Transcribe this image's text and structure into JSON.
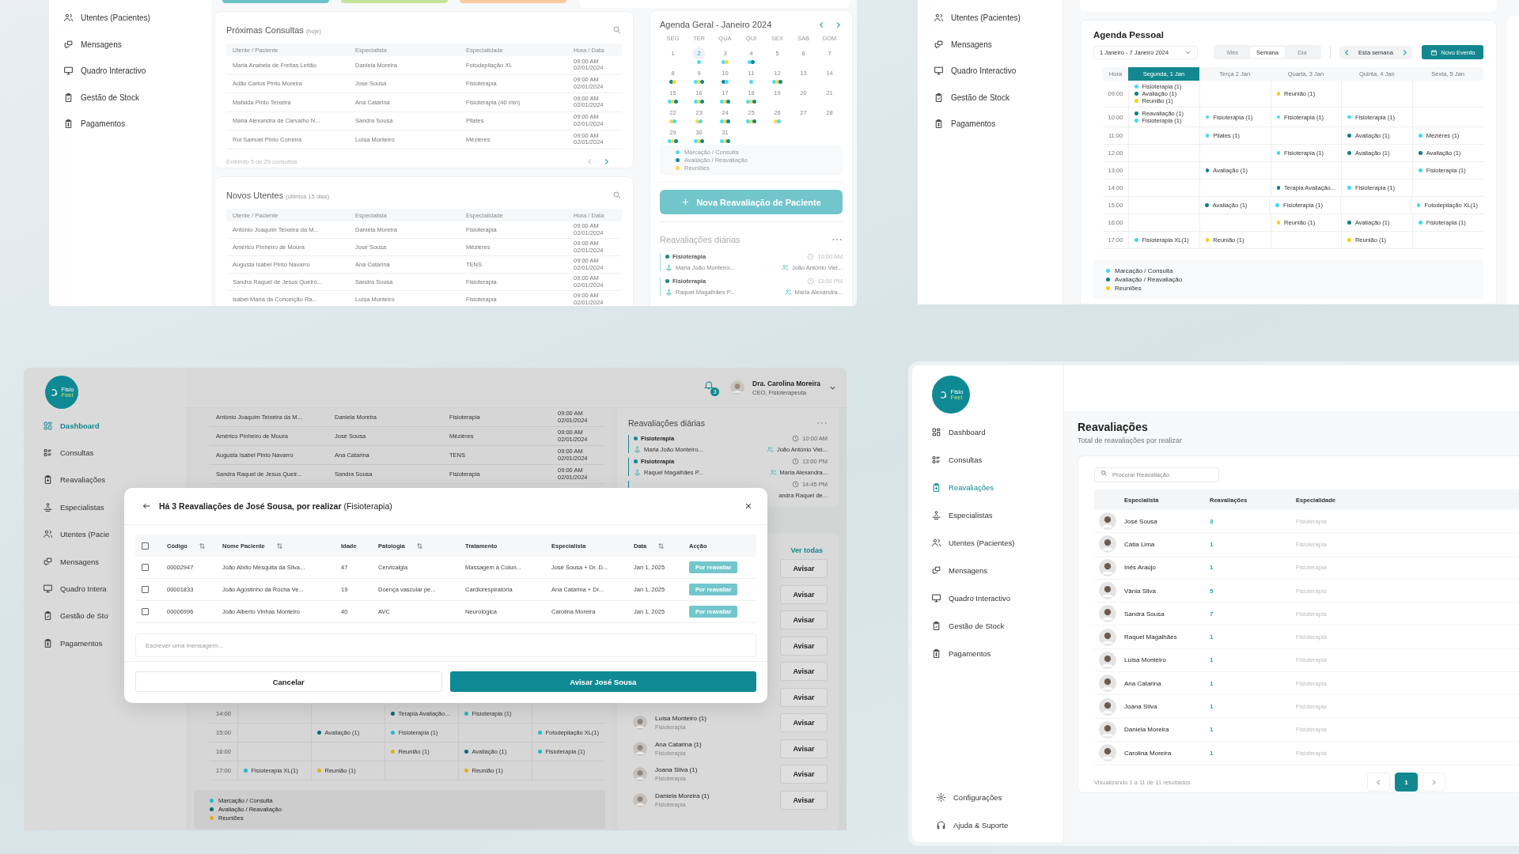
{
  "dashboard_screen": {
    "sidebar": [
      {
        "label": "Utentes (Pacientes)",
        "selected": false
      },
      {
        "label": "Mensagens",
        "selected": false
      },
      {
        "label": "Quadro Interactivo",
        "selected": false
      },
      {
        "label": "Gestão de Stock",
        "selected": false
      },
      {
        "label": "Pagamentos",
        "selected": false
      }
    ],
    "upcoming": {
      "title": "Próximas Consultas",
      "note": "(hoje)",
      "columns": [
        "Utente / Paciente",
        "Especialista",
        "Especialidade",
        "Hora / Data"
      ],
      "rows": [
        {
          "patient": "Maria Anabela de Freitas Leitão",
          "specialist": "Daniela Moreira",
          "specialty": "Fotodepilação XL",
          "time": "09:00 AM",
          "date": "02/01/2024"
        },
        {
          "patient": "Adão Carlos Pinto Moreira",
          "specialist": "Jose Sousa",
          "specialty": "Fisioterapia",
          "time": "09:00 AM",
          "date": "02/01/2024"
        },
        {
          "patient": "Mafalda Pinto Teixeira",
          "specialist": "Ana Catarina",
          "specialty": "Fisioterapia (40 min)",
          "time": "09:00 AM",
          "date": "02/01/2024"
        },
        {
          "patient": "Maria Alexandra de Carvalho N...",
          "specialist": "Sandra Sousa",
          "specialty": "Pilates",
          "time": "09:00 AM",
          "date": "02/01/2024"
        },
        {
          "patient": "Rui Samuel Pinto Correira",
          "specialist": "Luísa Monteiro",
          "specialty": "Mézières",
          "time": "09:00 AM",
          "date": "02/01/2024"
        }
      ],
      "footer": "Exibindo 5 de 25 consultas"
    },
    "new_patients": {
      "title": "Novos Utentes",
      "note": "(últimos 15 dias)",
      "columns": [
        "Utente / Paciente",
        "Especialista",
        "Especialidade",
        "Hora / Data"
      ],
      "rows": [
        {
          "patient": "António Joaquim Teixeira da M...",
          "specialist": "Daniela Moreira",
          "specialty": "Fisioterapia",
          "time": "09:00 AM",
          "date": "02/01/2024"
        },
        {
          "patient": "Américo Pinheiro de Moura",
          "specialist": "José Sousa",
          "specialty": "Mézières",
          "time": "09:00 AM",
          "date": "02/01/2024"
        },
        {
          "patient": "Augusta Isabel Pinto Navarro",
          "specialist": "Ana Catarina",
          "specialty": "TENS",
          "time": "09:00 AM",
          "date": "02/01/2024"
        },
        {
          "patient": "Sandra Raquel de Jesus Queiró...",
          "specialist": "Sandra Sousa",
          "specialty": "Fisioterapia",
          "time": "09:00 AM",
          "date": "02/01/2024"
        },
        {
          "patient": "Isabel Maria da Conceição Ra...",
          "specialist": "Luísa Monteiro",
          "specialty": "Fisioterapia",
          "time": "09:00 AM",
          "date": "02/01/2024"
        }
      ]
    },
    "calendar": {
      "title": "Agenda Geral - Janeiro 2024",
      "weekdays": [
        "SEG",
        "TER",
        "QUA",
        "QUI",
        "SEX",
        "SAB",
        "DOM"
      ],
      "days": [
        {
          "day": "1",
          "selected": false
        },
        {
          "day": "2",
          "selected": true,
          "events": [
            {
              "kind": "consulta"
            }
          ]
        },
        {
          "day": "3",
          "selected": false,
          "events": [
            {
              "kind": "consulta"
            },
            {
              "kind": "reuniao"
            }
          ]
        },
        {
          "day": "4",
          "selected": false,
          "events": [
            {
              "kind": "consulta"
            },
            {
              "kind": "avaliacao"
            }
          ]
        },
        {
          "day": "5",
          "selected": false
        },
        {
          "day": "6",
          "selected": false
        },
        {
          "day": "7",
          "selected": false
        },
        {
          "day": "8",
          "selected": false,
          "events": [
            {
              "kind": "avaliacao"
            },
            {
              "kind": "reuniao"
            }
          ]
        },
        {
          "day": "9",
          "selected": false,
          "events": [
            {
              "kind": "consulta"
            },
            {
              "kind": "reuniao"
            },
            {
              "kind": "avaliacao"
            }
          ]
        },
        {
          "day": "10",
          "selected": false,
          "events": [
            {
              "kind": "avaliacao"
            },
            {
              "kind": "consulta"
            }
          ]
        },
        {
          "day": "11",
          "selected": false,
          "events": [
            {
              "kind": "consulta"
            }
          ]
        },
        {
          "day": "12",
          "selected": false,
          "events": [
            {
              "kind": "consulta"
            },
            {
              "kind": "reuniao"
            },
            {
              "kind": "avaliacao"
            }
          ]
        },
        {
          "day": "13",
          "selected": false
        },
        {
          "day": "14",
          "selected": false
        },
        {
          "day": "15",
          "selected": false,
          "events": [
            {
              "kind": "consulta"
            },
            {
              "kind": "reuniao"
            },
            {
              "kind": "avaliacao"
            }
          ]
        },
        {
          "day": "16",
          "selected": false,
          "events": [
            {
              "kind": "consulta"
            },
            {
              "kind": "reuniao"
            },
            {
              "kind": "avaliacao"
            }
          ]
        },
        {
          "day": "17",
          "selected": false,
          "events": [
            {
              "kind": "consulta"
            },
            {
              "kind": "reuniao"
            },
            {
              "kind": "avaliacao"
            }
          ]
        },
        {
          "day": "18",
          "selected": false,
          "events": [
            {
              "kind": "consulta"
            },
            {
              "kind": "reuniao"
            },
            {
              "kind": "avaliacao"
            }
          ]
        },
        {
          "day": "19",
          "selected": false
        },
        {
          "day": "20",
          "selected": false
        },
        {
          "day": "21",
          "selected": false
        },
        {
          "day": "22",
          "selected": false,
          "events": [
            {
              "kind": "reuniao"
            },
            {
              "kind": "consulta"
            }
          ]
        },
        {
          "day": "23",
          "selected": false,
          "events": [
            {
              "kind": "reuniao"
            },
            {
              "kind": "consulta"
            }
          ]
        },
        {
          "day": "24",
          "selected": false,
          "events": [
            {
              "kind": "consulta"
            },
            {
              "kind": "reuniao"
            },
            {
              "kind": "avaliacao"
            }
          ]
        },
        {
          "day": "25",
          "selected": false,
          "events": [
            {
              "kind": "consulta"
            },
            {
              "kind": "reuniao"
            },
            {
              "kind": "avaliacao"
            }
          ]
        },
        {
          "day": "26",
          "selected": false,
          "events": [
            {
              "kind": "reuniao"
            },
            {
              "kind": "consulta"
            }
          ]
        },
        {
          "day": "27",
          "selected": false
        },
        {
          "day": "28",
          "selected": false
        },
        {
          "day": "29",
          "selected": false,
          "events": [
            {
              "kind": "consulta"
            },
            {
              "kind": "reuniao"
            },
            {
              "kind": "avaliacao"
            }
          ]
        },
        {
          "day": "30",
          "selected": false,
          "events": [
            {
              "kind": "consulta"
            },
            {
              "kind": "reuniao"
            },
            {
              "kind": "avaliacao"
            }
          ]
        },
        {
          "day": "31",
          "selected": false,
          "events": [
            {
              "kind": "consulta"
            },
            {
              "kind": "reuniao"
            },
            {
              "kind": "avaliacao"
            }
          ]
        }
      ],
      "legend": [
        {
          "label": "Marcação / Consulta",
          "kind": "consulta",
          "color": "#4fdcee"
        },
        {
          "label": "Avaliação / Reavaliação",
          "kind": "avaliacao",
          "color": "#16878f"
        },
        {
          "label": "Reuniões",
          "kind": "reuniao",
          "color": "#f6d84a"
        }
      ]
    },
    "new_button": "Nova Reavaliação de Paciente",
    "daily": {
      "title": "Reavaliações diárias",
      "entries": [
        {
          "type": "Fisioterapia",
          "time": "10:00 AM",
          "patient": "Maria João Monteiro...",
          "specialist": "João António Viei..."
        },
        {
          "type": "Fisioterapia",
          "time": "13:00 PM",
          "patient": "Raquel Magalhães P...",
          "specialist": "Maria Alexandra..."
        }
      ]
    }
  },
  "agenda_screen": {
    "sidebar": [
      {
        "label": "Utentes (Pacientes)",
        "selected": false
      },
      {
        "label": "Mensagens",
        "selected": false
      },
      {
        "label": "Quadro Interactivo",
        "selected": false
      },
      {
        "label": "Gestão de Stock",
        "selected": false
      },
      {
        "label": "Pagamentos",
        "selected": false
      }
    ],
    "title": "Agenda Pessoal",
    "range": "1 Janeiro - 7 Janeiro 2024",
    "views": [
      {
        "label": "Mês",
        "selected": false
      },
      {
        "label": "Semana",
        "selected": true
      },
      {
        "label": "Dia",
        "selected": false
      }
    ],
    "week_label": "Esta semana",
    "new_event": "Novo Evento",
    "hour_header": "Hora",
    "columns": [
      {
        "label": "Segunda, 1 Jan",
        "selected": true
      },
      {
        "label": "Terça 2 Jan",
        "selected": false
      },
      {
        "label": "Quarta, 3 Jan",
        "selected": false
      },
      {
        "label": "Quinta, 4 Jan",
        "selected": false
      },
      {
        "label": "Sexta, 5 Jan",
        "selected": false
      }
    ],
    "rows": [
      {
        "hour": "09:00",
        "cells": [
          [
            {
              "label": "Fisioterapia (1)",
              "kind": "consulta"
            },
            {
              "label": "Avaliação (1)",
              "kind": "avaliacao"
            },
            {
              "label": "Reunião (1)",
              "kind": "reuniao"
            }
          ],
          [],
          [
            {
              "label": "Reunião (1)",
              "kind": "reuniao"
            }
          ],
          [],
          []
        ]
      },
      {
        "hour": "10:00",
        "cells": [
          [
            {
              "label": "Reavaliação (1)",
              "kind": "avaliacao"
            },
            {
              "label": "Fisioterapia (1)",
              "kind": "consulta"
            }
          ],
          [
            {
              "label": "Fisioterapia (1)",
              "kind": "consulta"
            }
          ],
          [
            {
              "label": "Fisioterapia (1)",
              "kind": "consulta"
            }
          ],
          [
            {
              "label": "Fisioterapia (1)",
              "kind": "consulta"
            }
          ],
          []
        ]
      },
      {
        "hour": "11:00",
        "cells": [
          [],
          [
            {
              "label": "Pilates (1)",
              "kind": "consulta"
            }
          ],
          [],
          [
            {
              "label": "Avaliação (1)",
              "kind": "avaliacao"
            }
          ],
          [
            {
              "label": "Mézières (1)",
              "kind": "consulta"
            }
          ]
        ]
      },
      {
        "hour": "12:00",
        "cells": [
          [],
          [],
          [
            {
              "label": "Fisioterapia (1)",
              "kind": "consulta"
            }
          ],
          [
            {
              "label": "Avaliação (1)",
              "kind": "avaliacao"
            }
          ],
          [
            {
              "label": "Avaliação (1)",
              "kind": "avaliacao"
            }
          ]
        ]
      },
      {
        "hour": "13:00",
        "cells": [
          [],
          [
            {
              "label": "Avaliação (1)",
              "kind": "avaliacao"
            }
          ],
          [],
          [],
          [
            {
              "label": "Fisioterapia (1)",
              "kind": "consulta"
            }
          ]
        ]
      },
      {
        "hour": "14:00",
        "cells": [
          [],
          [],
          [
            {
              "label": "Terapia Avaliação...",
              "kind": "avaliacao"
            }
          ],
          [
            {
              "label": "Fisioterapia (1)",
              "kind": "consulta"
            }
          ],
          []
        ]
      },
      {
        "hour": "15:00",
        "cells": [
          [],
          [
            {
              "label": "Avaliação (1)",
              "kind": "avaliacao"
            }
          ],
          [
            {
              "label": "Fisioterapia (1)",
              "kind": "consulta"
            }
          ],
          [],
          [
            {
              "label": "Fotodepilação XL(1)",
              "kind": "consulta"
            }
          ]
        ]
      },
      {
        "hour": "16:00",
        "cells": [
          [],
          [],
          [
            {
              "label": "Reunião (1)",
              "kind": "reuniao"
            }
          ],
          [
            {
              "label": "Avaliação (1)",
              "kind": "avaliacao"
            }
          ],
          [
            {
              "label": "Fisioterapia (1)",
              "kind": "consulta"
            }
          ]
        ]
      },
      {
        "hour": "17:00",
        "cells": [
          [
            {
              "label": "Fisioterapia XL(1)",
              "kind": "consulta"
            }
          ],
          [
            {
              "label": "Reunião (1)",
              "kind": "reuniao"
            }
          ],
          [],
          [
            {
              "label": "Reunião (1)",
              "kind": "reuniao"
            }
          ],
          []
        ]
      }
    ],
    "legend": [
      {
        "label": "Marcação / Consulta",
        "kind": "consulta",
        "color": "#3fdcf0"
      },
      {
        "label": "Avaliação / Reavaliação",
        "kind": "avaliacao",
        "color": "#0f7f88"
      },
      {
        "label": "Reuniões",
        "kind": "reuniao",
        "color": "#f6cf10"
      }
    ]
  },
  "modal_screen": {
    "logo": {
      "line1": "Fisio",
      "line2": "Feel"
    },
    "sidebar": [
      {
        "label": "Dashboard",
        "selected": true
      },
      {
        "label": "Consultas",
        "selected": false
      },
      {
        "label": "Reavaliações",
        "selected": false
      },
      {
        "label": "Especialistas",
        "selected": false
      },
      {
        "label": "Utentes (Pacie",
        "selected": false
      },
      {
        "label": "Mensagens",
        "selected": false
      },
      {
        "label": "Quadro Intera",
        "selected": false
      },
      {
        "label": "Gestão de Sto",
        "selected": false
      },
      {
        "label": "Pagamentos",
        "selected": false
      }
    ],
    "notifications": "3",
    "user": {
      "name": "Dra. Carolina Moreira",
      "role": "CEO, Fisioterapeuta"
    },
    "table_rows": [
      {
        "patient": "António Joaquim Teixeira da M...",
        "specialist": "Daniela Moreira",
        "specialty": "Fisioterapia",
        "time": "09:00 AM",
        "date": "02/01/2024"
      },
      {
        "patient": "Américo Pinheiro de Moura",
        "specialist": "José Sousa",
        "specialty": "Mézières",
        "time": "09:00 AM",
        "date": "02/01/2024"
      },
      {
        "patient": "Augusta Isabel Pinto Navarro",
        "specialist": "Ana Catarina",
        "specialty": "TENS",
        "time": "09:00 AM",
        "date": "02/01/2024"
      },
      {
        "patient": "Sandra Raquel de Jesus Queir...",
        "specialist": "Sandra Sousa",
        "specialty": "Fisioterapia",
        "time": "09:00 AM",
        "date": "02/01/2024"
      }
    ],
    "agenda_rows": [
      {
        "hour": "14:00",
        "cells": [
          [],
          [],
          [
            {
              "label": "Terapia Avaliação...",
              "kind": "avaliacao"
            }
          ],
          [
            {
              "label": "Fisioterapia (1)",
              "kind": "consulta"
            }
          ],
          []
        ]
      },
      {
        "hour": "15:00",
        "cells": [
          [],
          [
            {
              "label": "Avaliação (1)",
              "kind": "avaliacao"
            }
          ],
          [
            {
              "label": "Fisioterapia (1)",
              "kind": "consulta"
            }
          ],
          [],
          [
            {
              "label": "Fotodepilação XL(1)",
              "kind": "consulta"
            }
          ]
        ]
      },
      {
        "hour": "16:00",
        "cells": [
          [],
          [],
          [
            {
              "label": "Reunião (1)",
              "kind": "reuniao"
            }
          ],
          [
            {
              "label": "Avaliação (1)",
              "kind": "avaliacao"
            }
          ],
          [
            {
              "label": "Fisioterapia (1)",
              "kind": "consulta"
            }
          ]
        ]
      },
      {
        "hour": "17:00",
        "cells": [
          [
            {
              "label": "Fisioterapia XL(1)",
              "kind": "consulta"
            }
          ],
          [
            {
              "label": "Reunião (1)",
              "kind": "reuniao"
            }
          ],
          [],
          [
            {
              "label": "Reunião (1)",
              "kind": "reuniao"
            }
          ],
          []
        ]
      }
    ],
    "legend": [
      {
        "label": "Marcação / Consulta",
        "kind": "consulta",
        "color": "#26b8c9"
      },
      {
        "label": "Avaliação / Reavaliação",
        "kind": "avaliacao",
        "color": "#0d6b73"
      },
      {
        "label": "Reuniões",
        "kind": "reuniao",
        "color": "#d9b21a"
      }
    ],
    "daily": {
      "title": "Reavaliações diárias",
      "entries": [
        {
          "type": "Fisioterapia",
          "time": "10:00 AM",
          "patient": "Maria João Monteiro...",
          "specialist": "João António Viei..."
        },
        {
          "type": "Fisioterapia",
          "time": "13:00 PM",
          "patient": "Raquel Magalhães P...",
          "specialist": "Maria Alexandra..."
        },
        {
          "time": "14:45 PM",
          "specialist": "andra Raquel de..."
        }
      ]
    },
    "see_all": "Ver todas",
    "notify_rows": [
      {
        "button": "Avisar"
      },
      {
        "button": "Avisar"
      },
      {
        "button": "Avisar"
      },
      {
        "button": "Avisar"
      },
      {
        "button": "Avisar"
      },
      {
        "button": "Avisar"
      },
      {
        "name": "Luísa Monteiro (1)",
        "specialty": "Fisioterapia",
        "button": "Avisar"
      },
      {
        "name": "Ana Catarina (1)",
        "specialty": "Fisioterapia",
        "button": "Avisar"
      },
      {
        "name": "Joana Silva (1)",
        "specialty": "Fisioterapia",
        "button": "Avisar"
      },
      {
        "name": "Daniela Moreira (1)",
        "specialty": "Fisioterapia",
        "button": "Avisar"
      }
    ],
    "modal": {
      "title": "**Há 3 Reavaliações de José Sousa, por realizar** (Fisioterapia)",
      "all_checked": false,
      "columns": [
        {
          "label": "Código",
          "sortable": true
        },
        {
          "label": "Nome Paciente",
          "sortable": true
        },
        {
          "label": "Idade",
          "sortable": false
        },
        {
          "label": "Patologia",
          "sortable": true
        },
        {
          "label": "Tratamento",
          "sortable": false
        },
        {
          "label": "Especialista",
          "sortable": false
        },
        {
          "label": "Data",
          "sortable": true
        },
        {
          "label": "Acção",
          "sortable": false
        }
      ],
      "rows": [
        {
          "checked": false,
          "cells": [
            "00002947",
            "João Abílio Mesquita da Silva...",
            "47",
            "Cervicalgia",
            "Massagem à Colun...",
            "José Sousa + Dr. D...",
            "Jan 1, 2025"
          ],
          "status": "Por reavaliar"
        },
        {
          "checked": false,
          "cells": [
            "00001833",
            "João Agostinho da Rocha Ve...",
            "19",
            "Doença vascular pe...",
            "Cardiorespiratória",
            "Ana Catarina + Dr...",
            "Jan 1, 2025"
          ],
          "status": "Por reavaliar"
        },
        {
          "checked": false,
          "cells": [
            "00006996",
            "João Alberto Vinhas Monteiro",
            "40",
            "AVC",
            "Neurológica",
            "Carolina Moreira",
            "Jan 1, 2025"
          ],
          "status": "Por reavaliar"
        }
      ],
      "placeholder": "Escrever uma mensagem...",
      "cancel": "Cancelar",
      "confirm": "Avisar José Sousa"
    }
  },
  "reavaliacoes_screen": {
    "logo": {
      "line1": "Fisio",
      "line2": "Feel"
    },
    "sidebar": [
      {
        "label": "Dashboard",
        "selected": false
      },
      {
        "label": "Consultas",
        "selected": false
      },
      {
        "label": "Reavaliações",
        "selected": true
      },
      {
        "label": "Especialistas",
        "selected": false
      },
      {
        "label": "Utentes (Pacientes)",
        "selected": false
      },
      {
        "label": "Mensagens",
        "selected": false
      },
      {
        "label": "Quadro Interactivo",
        "selected": false
      },
      {
        "label": "Gestão de Stock",
        "selected": false
      },
      {
        "label": "Pagamentos",
        "selected": false
      }
    ],
    "footer_nav": [
      {
        "label": "Configurações",
        "selected": false
      },
      {
        "label": "Ajuda & Suporte",
        "selected": false
      }
    ],
    "title": "Reavaliações",
    "subtitle": "Total de reavaliações por realizar",
    "search_placeholder": "Procurar Reavaliação",
    "columns": [
      "Especialista",
      "Reavaliações",
      "Especialidade"
    ],
    "rows": [
      {
        "name": "José Sousa",
        "count": "3",
        "specialty": "Fisioterapia"
      },
      {
        "name": "Cátia Lima",
        "count": "1",
        "specialty": "Fisioterapia"
      },
      {
        "name": "Inês Araújo",
        "count": "1",
        "specialty": "Fisioterapia"
      },
      {
        "name": "Vânia Silva",
        "count": "5",
        "specialty": "Fisioterapia"
      },
      {
        "name": "Sandra Sousa",
        "count": "7",
        "specialty": "Fisioterapia"
      },
      {
        "name": "Raquel Magalhães",
        "count": "1",
        "specialty": "Fisioterapia"
      },
      {
        "name": "Luísa Monteiro",
        "count": "1",
        "specialty": "Fisioterapia"
      },
      {
        "name": "Ana Catarina",
        "count": "1",
        "specialty": "Fisioterapia"
      },
      {
        "name": "Joana Silva",
        "count": "1",
        "specialty": "Fisioterapia"
      },
      {
        "name": "Daniela Moreira",
        "count": "1",
        "specialty": "Fisioterapia"
      },
      {
        "name": "Carolina Moreira",
        "count": "1",
        "specialty": "Fisioterapia"
      }
    ],
    "footer": "Visualizando 1 a 11 de 11 resultados",
    "pages": [
      {
        "label": "1",
        "selected": true
      }
    ]
  }
}
